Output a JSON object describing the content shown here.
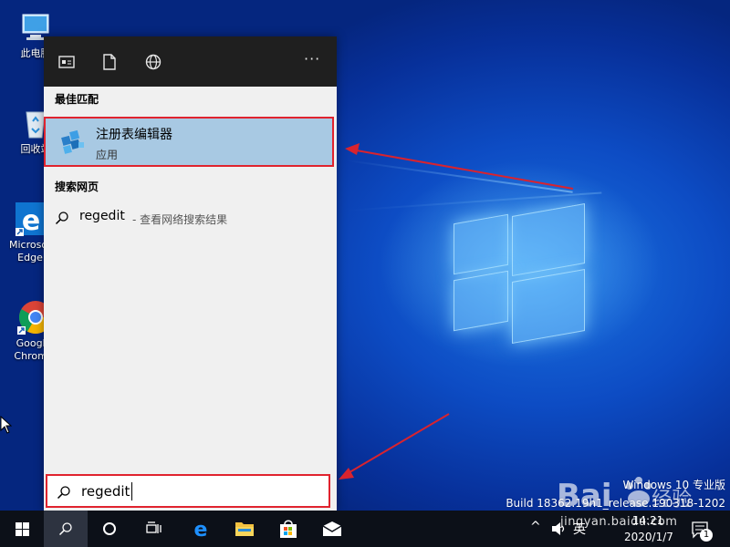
{
  "desktop": {
    "icons": [
      {
        "label": "此电脑",
        "icon": "this-pc-icon"
      },
      {
        "label": "回收站",
        "icon": "recycle-bin-icon"
      },
      {
        "label_line1": "Microsoft",
        "label_line2": "Edge",
        "icon": "edge-icon"
      },
      {
        "label_line1": "Google",
        "label_line2": "Chrome",
        "icon": "chrome-icon"
      }
    ]
  },
  "search_panel": {
    "header_icons": [
      "apps-filter-icon",
      "documents-filter-icon",
      "web-filter-icon",
      "more-options-icon"
    ],
    "more_label": "···",
    "best_match_title": "最佳匹配",
    "best_match": {
      "name": "注册表编辑器",
      "type": "应用",
      "icon": "registry-editor-icon"
    },
    "web_title": "搜索网页",
    "web_result": {
      "query": "regedit",
      "suffix": " - 查看网络搜索结果"
    },
    "search_box": {
      "value": "regedit"
    }
  },
  "taskbar": {
    "buttons": [
      "start-icon",
      "search-icon",
      "cortana-icon",
      "task-view-icon",
      "edge-icon",
      "file-explorer-icon",
      "store-icon",
      "mail-icon"
    ],
    "tray": {
      "chevron": "^",
      "ime": "英",
      "time": "14:21",
      "date": "2020/1/7",
      "notification_count": "1"
    }
  },
  "watermark": {
    "build_line1": "Windows 10 专业版",
    "build_line2": "Build 18362.19h1_release.190318-1202",
    "logo_text": "Bai",
    "logo_cn": "经验",
    "url": "jingyan.baidu.com"
  },
  "colors": {
    "accent_red": "#e0232e",
    "highlight_blue": "#a8c9e3",
    "taskbar": "#0c1018",
    "header": "#1f1f1f"
  }
}
